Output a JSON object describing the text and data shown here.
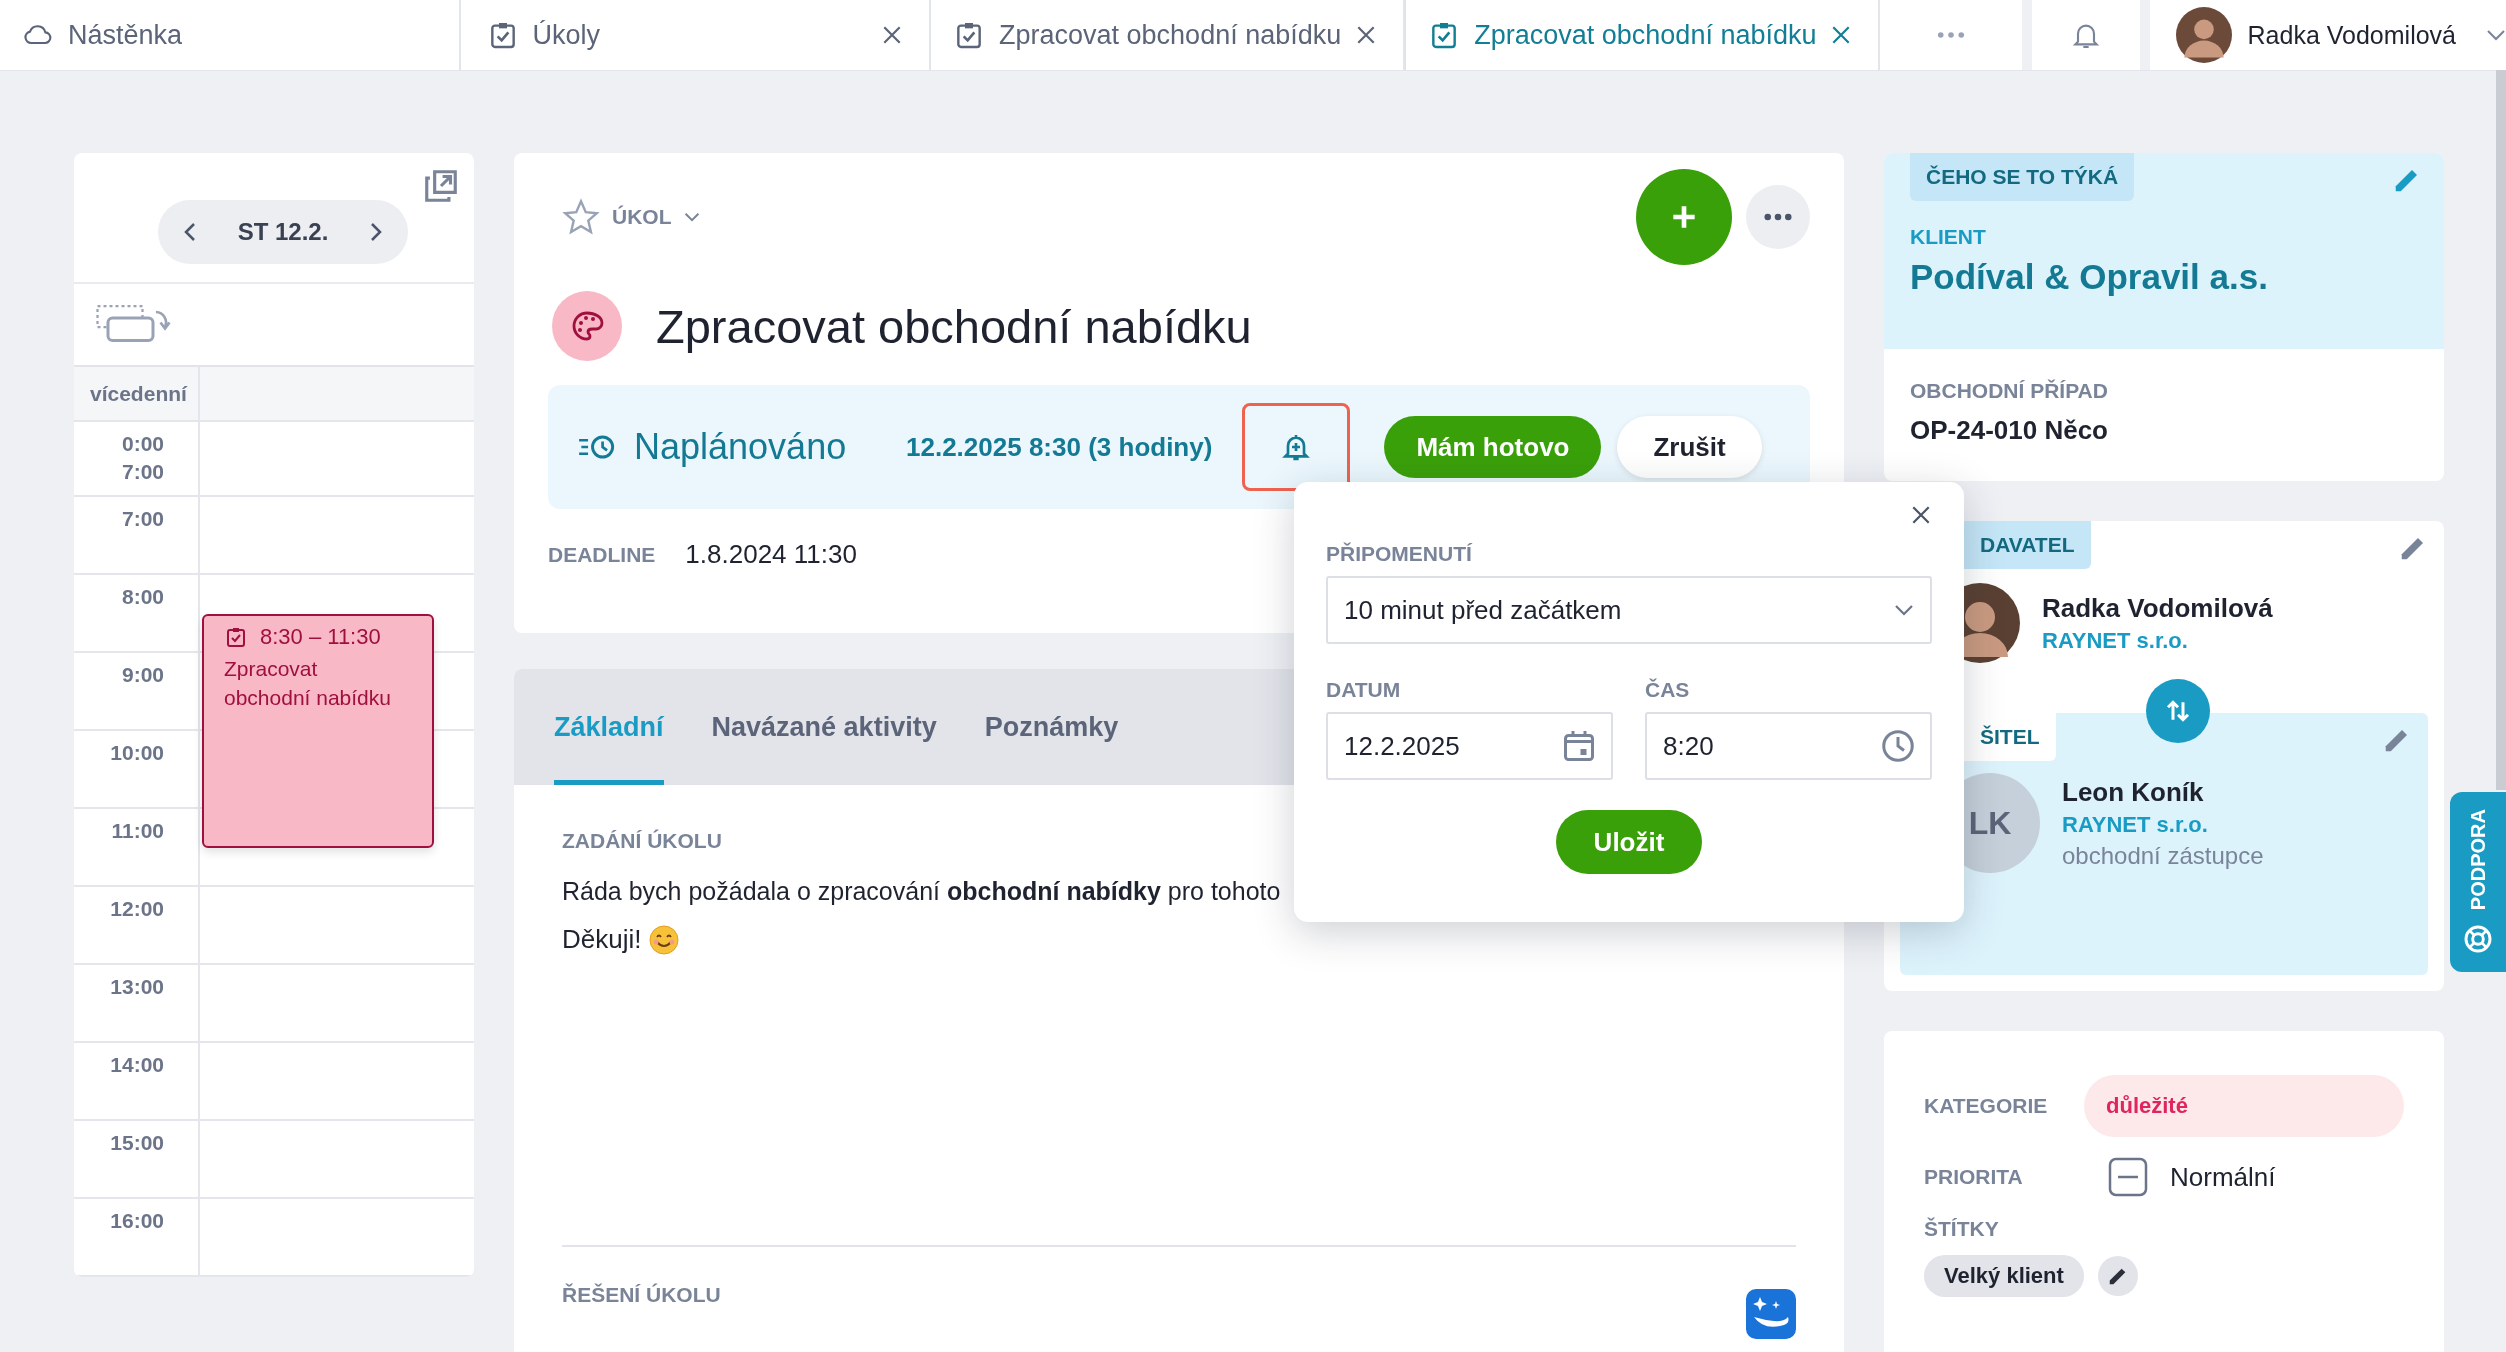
{
  "topbar": {
    "tabs": [
      {
        "kind": "home",
        "label": "Nástěnka",
        "closable": false,
        "selected": false
      },
      {
        "kind": "task",
        "label": "Úkoly",
        "closable": true,
        "selected": false
      },
      {
        "kind": "task",
        "label": "Zpracovat obchodní nabídku",
        "closable": true,
        "selected": false
      },
      {
        "kind": "task",
        "label": "Zpracovat obchodní nabídku",
        "closable": true,
        "selected": true
      }
    ],
    "user": {
      "name": "Radka Vodomilová"
    }
  },
  "calendar": {
    "date": "ST 12.2.",
    "allday_label": "vícedenní",
    "collapsed": [
      "0:00",
      "7:00"
    ],
    "hours": [
      "7:00",
      "8:00",
      "9:00",
      "10:00",
      "11:00",
      "12:00",
      "13:00",
      "14:00",
      "15:00",
      "16:00"
    ],
    "event": {
      "time": "8:30 – 11:30",
      "title": "Zpracovat obchodní nabídku"
    }
  },
  "task": {
    "type_label": "ÚKOL",
    "starred": false,
    "title": "Zpracovat obchodní nabídku",
    "status": "Naplánováno",
    "schedule": "12.2.2025 8:30 (3 hodiny)",
    "reminder_highlighted": true,
    "done_button": "Mám hotovo",
    "cancel_button": "Zrušit",
    "deadline_label": "DEADLINE",
    "deadline": "1.8.2024 11:30"
  },
  "detail": {
    "tabs": [
      {
        "label": "Základní",
        "selected": true
      },
      {
        "label": "Navázané aktivity",
        "selected": false
      },
      {
        "label": "Poznámky",
        "selected": false
      }
    ],
    "assignment_label": "ZADÁNÍ ÚKOLU",
    "assignment_text": "Ráda bych požádala o zpracování **obchodní nabídky** pro tohoto",
    "closing": "Děkuji!",
    "solution_label": "ŘEŠENÍ ÚKOLU"
  },
  "reminder_popup": {
    "label": "PŘIPOMENUTÍ",
    "option": "10 minut před začátkem",
    "date_label": "DATUM",
    "date": "12.2.2025",
    "time_label": "ČAS",
    "time": "8:20",
    "save_button": "Uložit"
  },
  "relation": {
    "section_label": "ČEHO SE TO TÝKÁ",
    "client_label": "KLIENT",
    "client": "Podíval & Opravil a.s.",
    "deal_label": "OBCHODNÍ PŘÍPAD",
    "deal": "OP-24-010 Něco"
  },
  "people": {
    "requester_label": "DAVATEL",
    "requester": {
      "name": "Radka Vodomilová",
      "company": "RAYNET s.r.o."
    },
    "solver_label": "ŠITEL",
    "solver": {
      "initials": "LK",
      "name": "Leon Koník",
      "company": "RAYNET s.r.o.",
      "role": "obchodní zástupce"
    }
  },
  "properties": {
    "category_label": "KATEGORIE",
    "category": {
      "label": "důležité",
      "color": "#e0245e"
    },
    "priority_label": "PRIORITA",
    "priority": "Normální",
    "tags_label": "ŠTÍTKY",
    "tags": [
      "Velký klient"
    ]
  },
  "support_tab": "PODPORA"
}
